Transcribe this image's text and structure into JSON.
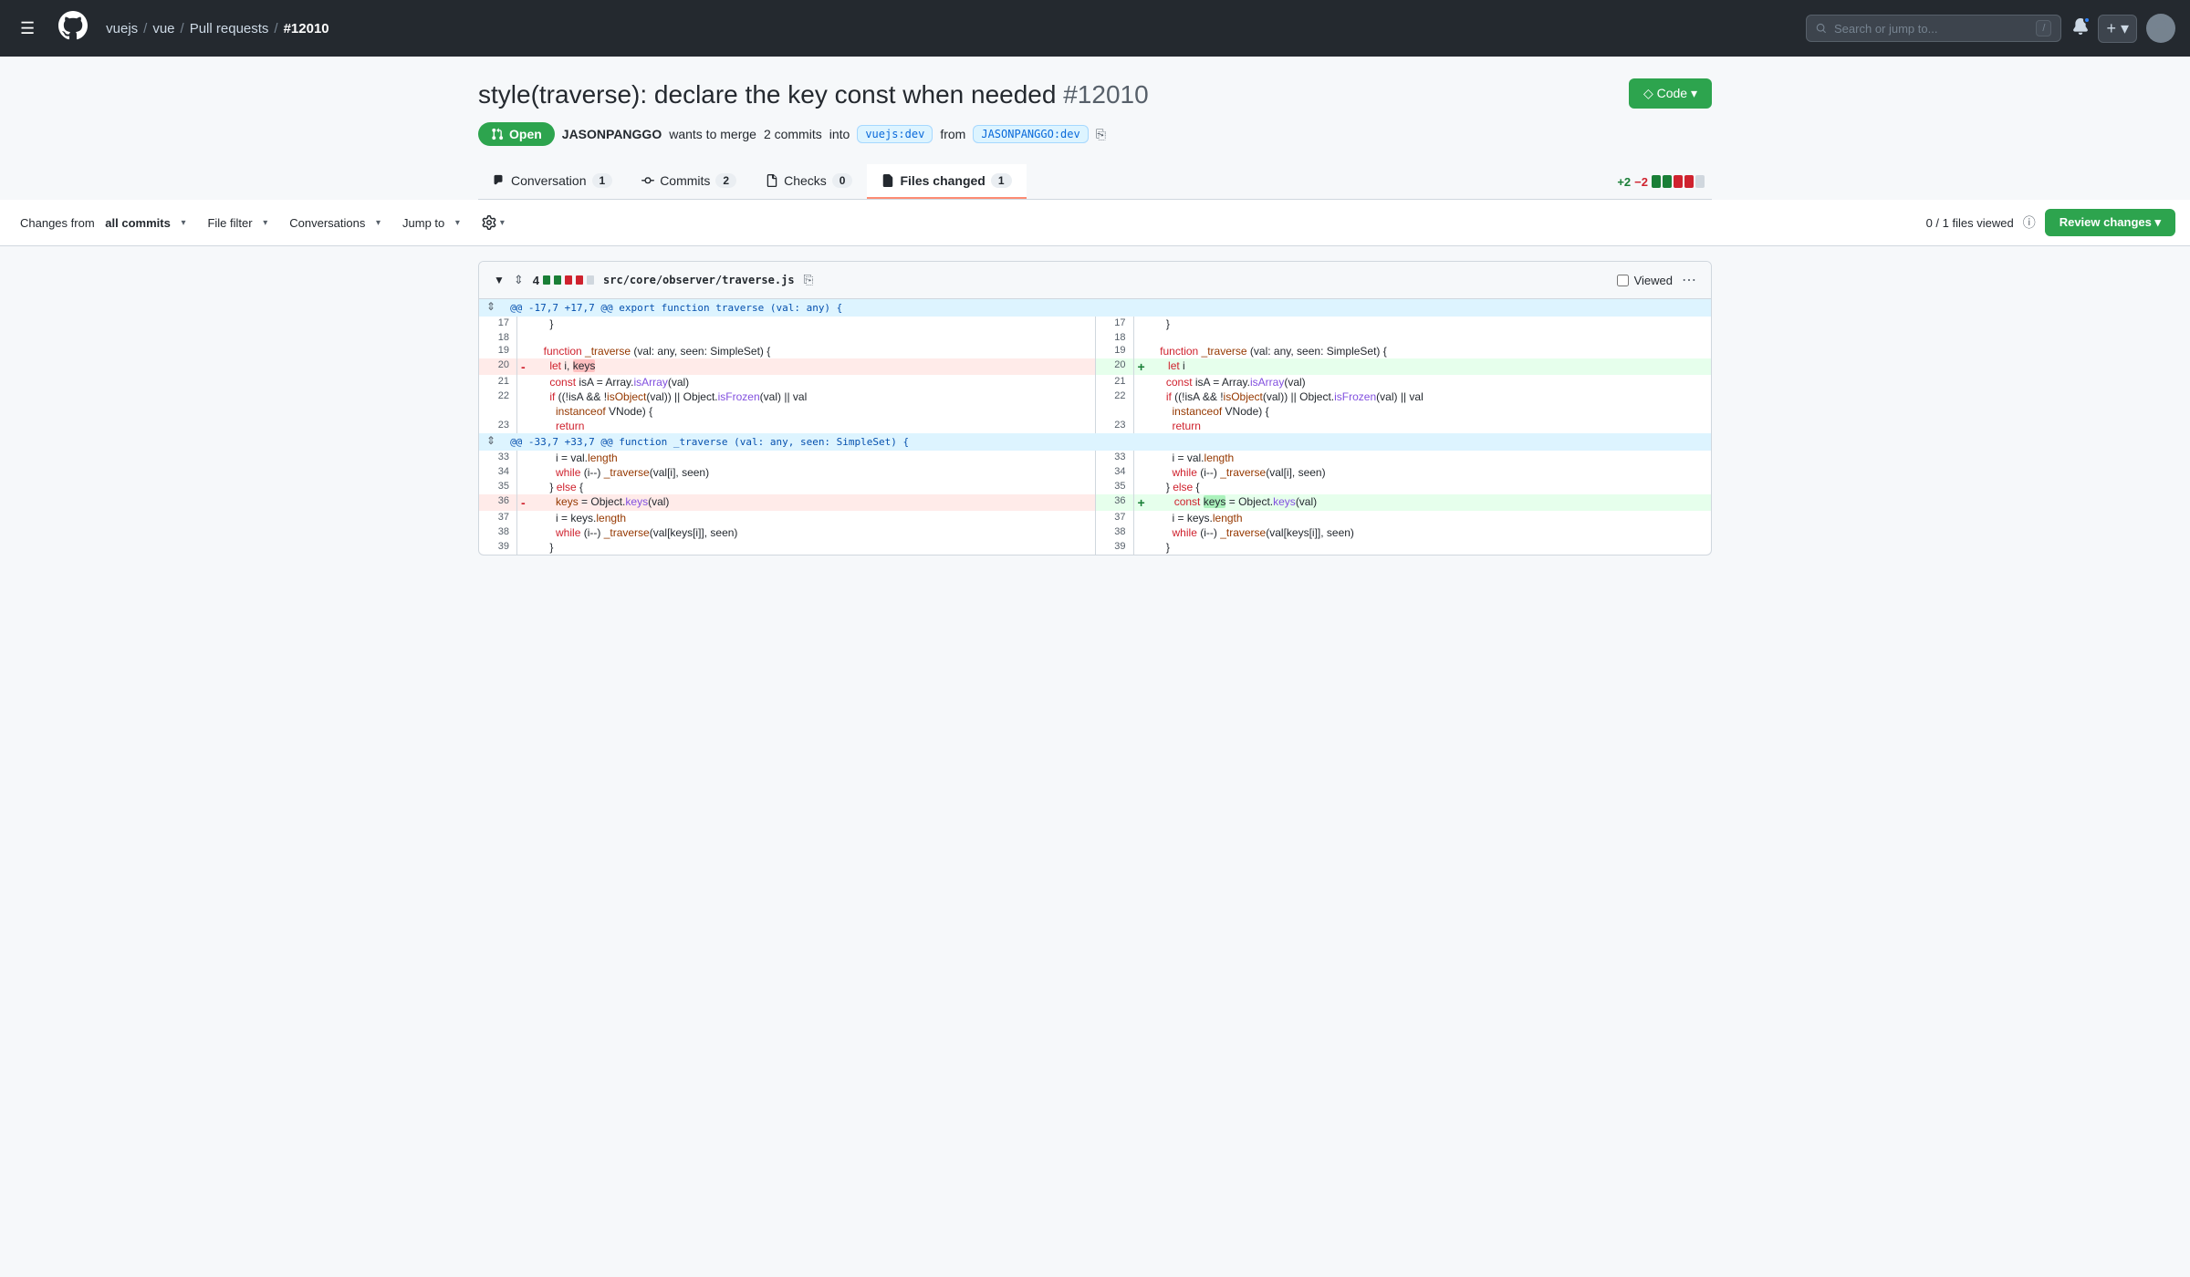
{
  "navbar": {
    "hamburger_label": "☰",
    "logo": "●",
    "breadcrumb": {
      "org": "vuejs",
      "repo": "vue",
      "section": "Pull requests",
      "pr_num": "#12010"
    },
    "search_placeholder": "Search or jump to...",
    "kbd": "/",
    "bell": "🔔",
    "plus": "+"
  },
  "pr": {
    "title": "style(traverse): declare the key const when needed",
    "num": "#12010",
    "code_btn": "◇ Code ▾",
    "status": "Open",
    "author": "JASONPANGGO",
    "action": "wants to merge",
    "commit_count": "2 commits",
    "into_label": "into",
    "target_branch": "vuejs:dev",
    "from_label": "from",
    "source_branch": "JASONPANGGO:dev"
  },
  "tabs": [
    {
      "id": "conversation",
      "label": "Conversation",
      "count": "1",
      "active": false
    },
    {
      "id": "commits",
      "label": "Commits",
      "count": "2",
      "active": false
    },
    {
      "id": "checks",
      "label": "Checks",
      "count": "0",
      "active": false
    },
    {
      "id": "files-changed",
      "label": "Files changed",
      "count": "1",
      "active": true
    }
  ],
  "diff_stats": {
    "add": "+2",
    "remove": "−2"
  },
  "toolbar": {
    "changes_from": "Changes from",
    "all_commits": "all commits",
    "file_filter": "File filter",
    "conversations": "Conversations",
    "jump_to": "Jump to",
    "files_viewed": "0 / 1 files viewed",
    "review_btn": "Review changes ▾"
  },
  "diff": {
    "file": {
      "count": 4,
      "filename": "src/core/observer/traverse.js",
      "viewed_label": "Viewed"
    },
    "hunk1": "@@ -17,7 +17,7 @@ export function traverse (val: any) {",
    "hunk2": "@@ -33,7 +33,7 @@ function _traverse (val: any, seen: SimpleSet) {",
    "lines": {
      "left": [
        {
          "num": "17",
          "type": "normal",
          "content": "    }"
        },
        {
          "num": "18",
          "type": "normal",
          "content": ""
        },
        {
          "num": "19",
          "type": "normal",
          "content": "  function _traverse (val: any, seen: SimpleSet) {"
        },
        {
          "num": "20",
          "type": "removed",
          "marker": "-",
          "content": "    let i, keys"
        },
        {
          "num": "21",
          "type": "normal",
          "content": "    const isA = Array.isArray(val)"
        },
        {
          "num": "22",
          "type": "normal",
          "content": "    if ((!isA && !isObject(val)) || Object.isFrozen(val) || val"
        },
        {
          "num": "",
          "type": "normal",
          "content": "      instanceof VNode) {"
        },
        {
          "num": "23",
          "type": "normal",
          "content": "      return"
        },
        {
          "num": "33",
          "type": "normal",
          "content": "      i = val.length"
        },
        {
          "num": "34",
          "type": "normal",
          "content": "      while (i--) _traverse(val[i], seen)"
        },
        {
          "num": "35",
          "type": "normal",
          "content": "    } else {"
        },
        {
          "num": "36",
          "type": "removed",
          "marker": "-",
          "content": "      keys = Object.keys(val)"
        },
        {
          "num": "37",
          "type": "normal",
          "content": "      i = keys.length"
        },
        {
          "num": "38",
          "type": "normal",
          "content": "      while (i--) _traverse(val[keys[i]], seen)"
        },
        {
          "num": "39",
          "type": "normal",
          "content": "    }"
        }
      ],
      "right": [
        {
          "num": "17",
          "type": "normal",
          "content": "    }"
        },
        {
          "num": "18",
          "type": "normal",
          "content": ""
        },
        {
          "num": "19",
          "type": "normal",
          "content": "  function _traverse (val: any, seen: SimpleSet) {"
        },
        {
          "num": "20",
          "type": "added",
          "marker": "+",
          "content": "    let i"
        },
        {
          "num": "21",
          "type": "normal",
          "content": "    const isA = Array.isArray(val)"
        },
        {
          "num": "22",
          "type": "normal",
          "content": "    if ((!isA && !isObject(val)) || Object.isFrozen(val) || val"
        },
        {
          "num": "",
          "type": "normal",
          "content": "      instanceof VNode) {"
        },
        {
          "num": "23",
          "type": "normal",
          "content": "      return"
        },
        {
          "num": "33",
          "type": "normal",
          "content": "      i = val.length"
        },
        {
          "num": "34",
          "type": "normal",
          "content": "      while (i--) _traverse(val[i], seen)"
        },
        {
          "num": "35",
          "type": "normal",
          "content": "    } else {"
        },
        {
          "num": "36",
          "type": "added",
          "marker": "+",
          "content": "      const keys = Object.keys(val)"
        },
        {
          "num": "37",
          "type": "normal",
          "content": "      i = keys.length"
        },
        {
          "num": "38",
          "type": "normal",
          "content": "      while (i--) _traverse(val[keys[i]], seen)"
        },
        {
          "num": "39",
          "type": "normal",
          "content": "    }"
        }
      ]
    }
  }
}
